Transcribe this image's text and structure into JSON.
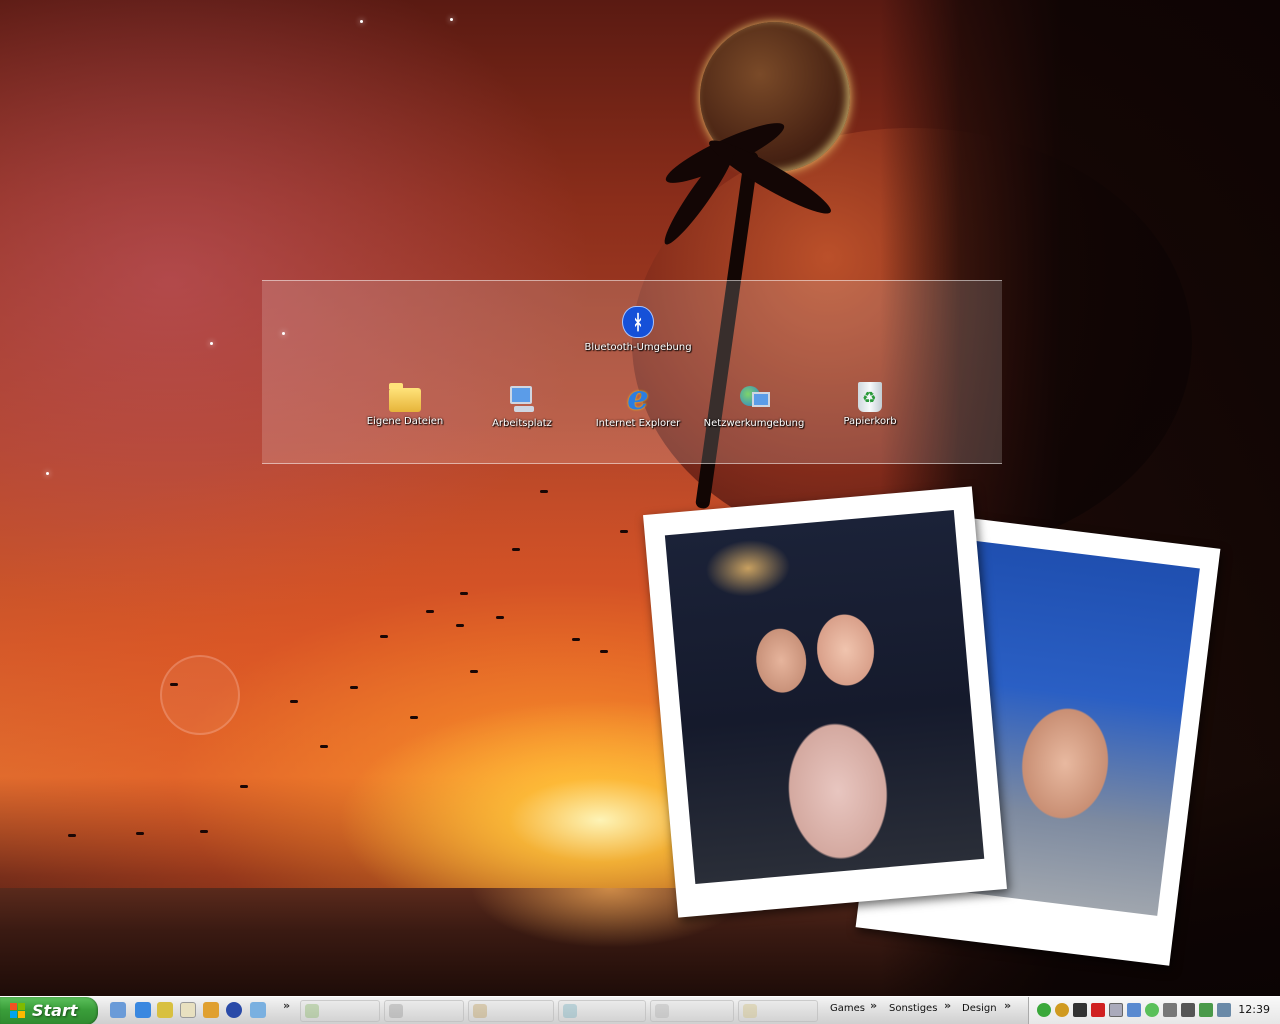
{
  "desktop": {
    "icons": {
      "bluetooth": "Bluetooth-Umgebung",
      "my_documents": "Eigene Dateien",
      "my_computer": "Arbeitsplatz",
      "internet_explorer": "Internet Explorer",
      "network": "Netzwerkumgebung",
      "recycle_bin": "Papierkorb"
    },
    "bluetooth_glyph": "ᚼ"
  },
  "taskbar": {
    "start_label": "Start",
    "quick_launch_more": "»",
    "toolbars": {
      "games": "Games",
      "sonstiges": "Sonstiges",
      "design": "Design",
      "chevron": "»"
    },
    "clock": "12:39"
  },
  "colors": {
    "start_green": "#3a9e3a",
    "taskbar_silver": "#e2e2e2"
  }
}
